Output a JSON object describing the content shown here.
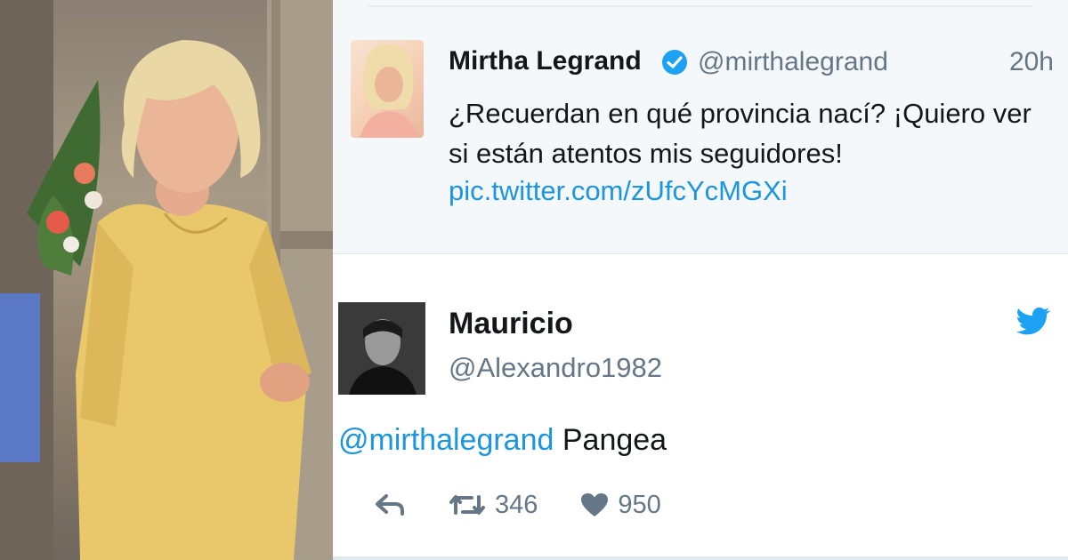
{
  "quoted_tweet": {
    "name": "Mirtha Legrand",
    "handle": "@mirthalegrand",
    "time": "20h",
    "text": "¿Recuerdan en qué provincia nací? ¡Quiero ver si están atentos mis seguidores!",
    "link": "pic.twitter.com/zUfcYcMGXi"
  },
  "reply_tweet": {
    "name": "Mauricio",
    "handle": "@Alexandro1982",
    "mention": "@mirthalegrand",
    "text": "Pangea",
    "retweet_count": "346",
    "like_count": "950"
  },
  "icons": [
    "verified-badge-icon",
    "twitter-bird-icon",
    "reply-icon",
    "retweet-icon",
    "heart-icon"
  ],
  "colors": {
    "link": "#1b95e0",
    "muted": "#657786",
    "text": "#14171a",
    "panel_bg": "#f5f8fa"
  }
}
